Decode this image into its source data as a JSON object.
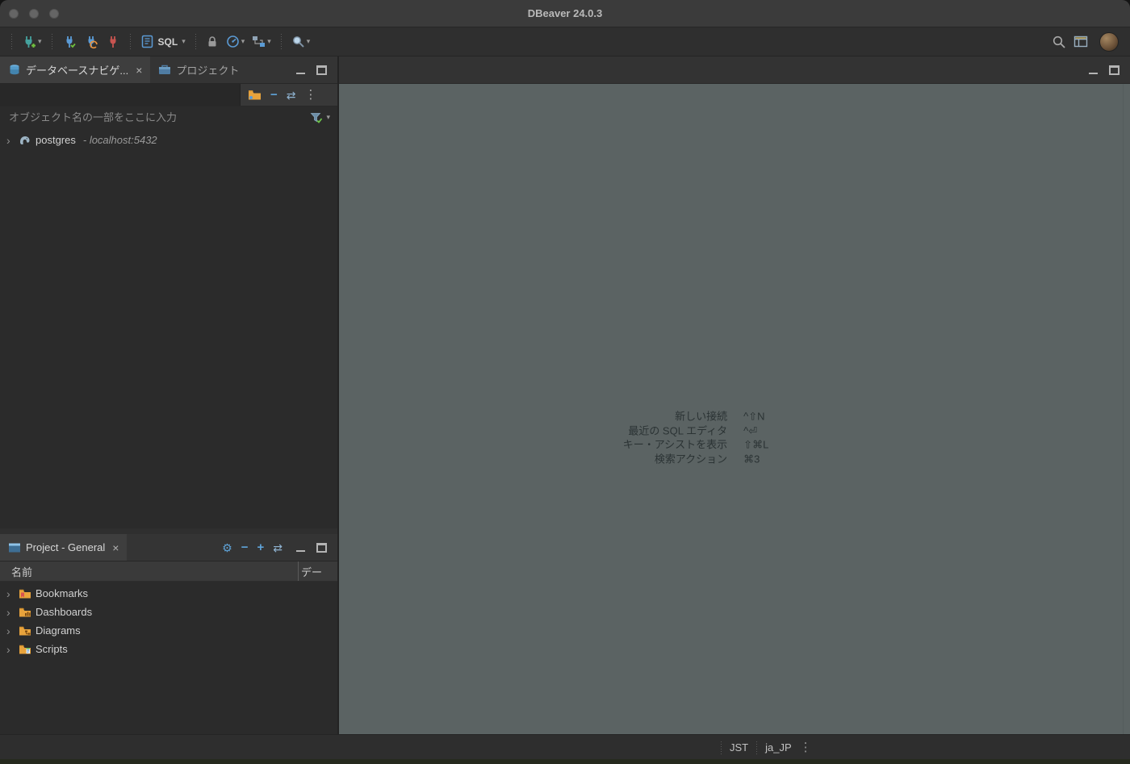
{
  "window": {
    "title": "DBeaver 24.0.3"
  },
  "icons": {
    "caret": "▾",
    "close": "×",
    "overflow": "⋮",
    "chevron": "›",
    "gear": "⚙",
    "minus": "−",
    "plus": "+",
    "link": "⇄"
  },
  "toolbar": {
    "sql_button_label": "SQL"
  },
  "navigator_panel": {
    "tabs": [
      {
        "label": "データベースナビゲ..."
      },
      {
        "label": "プロジェクト"
      }
    ],
    "filter_placeholder": "オブジェクト名の一部をここに入力",
    "tree": [
      {
        "name": "postgres",
        "detail": "- localhost:5432"
      }
    ]
  },
  "project_panel": {
    "tab_label": "Project - General",
    "columns": {
      "name": "名前",
      "second": "デー"
    },
    "items": [
      {
        "label": "Bookmarks"
      },
      {
        "label": "Dashboards"
      },
      {
        "label": "Diagrams"
      },
      {
        "label": "Scripts"
      }
    ]
  },
  "editor": {
    "shortcuts": [
      {
        "label": "新しい接続",
        "keys": "^⇧N"
      },
      {
        "label": "最近の SQL エディタ",
        "keys": "^⏎"
      },
      {
        "label": "キー・アシストを表示",
        "keys": "⇧⌘L"
      },
      {
        "label": "検索アクション",
        "keys": "⌘3"
      }
    ]
  },
  "status_bar": {
    "timezone": "JST",
    "locale": "ja_JP"
  }
}
